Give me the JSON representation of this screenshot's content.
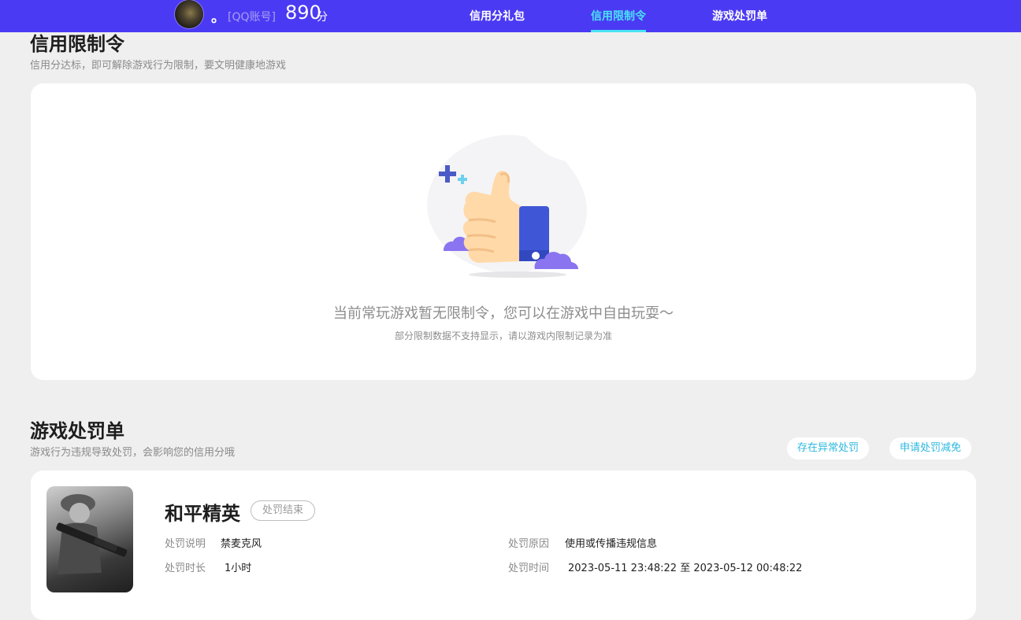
{
  "header": {
    "nickname": "。",
    "account_type": "[QQ账号]",
    "credit_score": "890",
    "score_unit": "分",
    "nav": [
      {
        "label": "信用分礼包",
        "active": false
      },
      {
        "label": "信用限制令",
        "active": true
      },
      {
        "label": "游戏处罚单",
        "active": false
      }
    ]
  },
  "restriction": {
    "title": "信用限制令",
    "subtitle": "信用分达标，即可解除游戏行为限制，要文明健康地游戏",
    "empty_title": "当前常玩游戏暂无限制令，您可以在游戏中自由玩耍～",
    "empty_note": "部分限制数据不支持显示，请以游戏内限制记录为准"
  },
  "penalty": {
    "title": "游戏处罚单",
    "subtitle": "游戏行为违规导致处罚，会影响您的信用分哦",
    "actions": {
      "abnormal": "存在异常处罚",
      "appeal": "申请处罚减免"
    },
    "item": {
      "game": "和平精英",
      "status": "处罚结束",
      "desc_label": "处罚说明",
      "desc_value": "禁麦克风",
      "duration_label": "处罚时长",
      "duration_value": "1小时",
      "reason_label": "处罚原因",
      "reason_value": "使用或传播违规信息",
      "time_label": "处罚时间",
      "time_value": "2023-05-11 23:48:22 至 2023-05-12 00:48:22"
    }
  },
  "colors": {
    "topbar": "#4b3af3",
    "accent": "#49e3f7",
    "link": "#2cb8df",
    "page_bg": "#efefef"
  }
}
